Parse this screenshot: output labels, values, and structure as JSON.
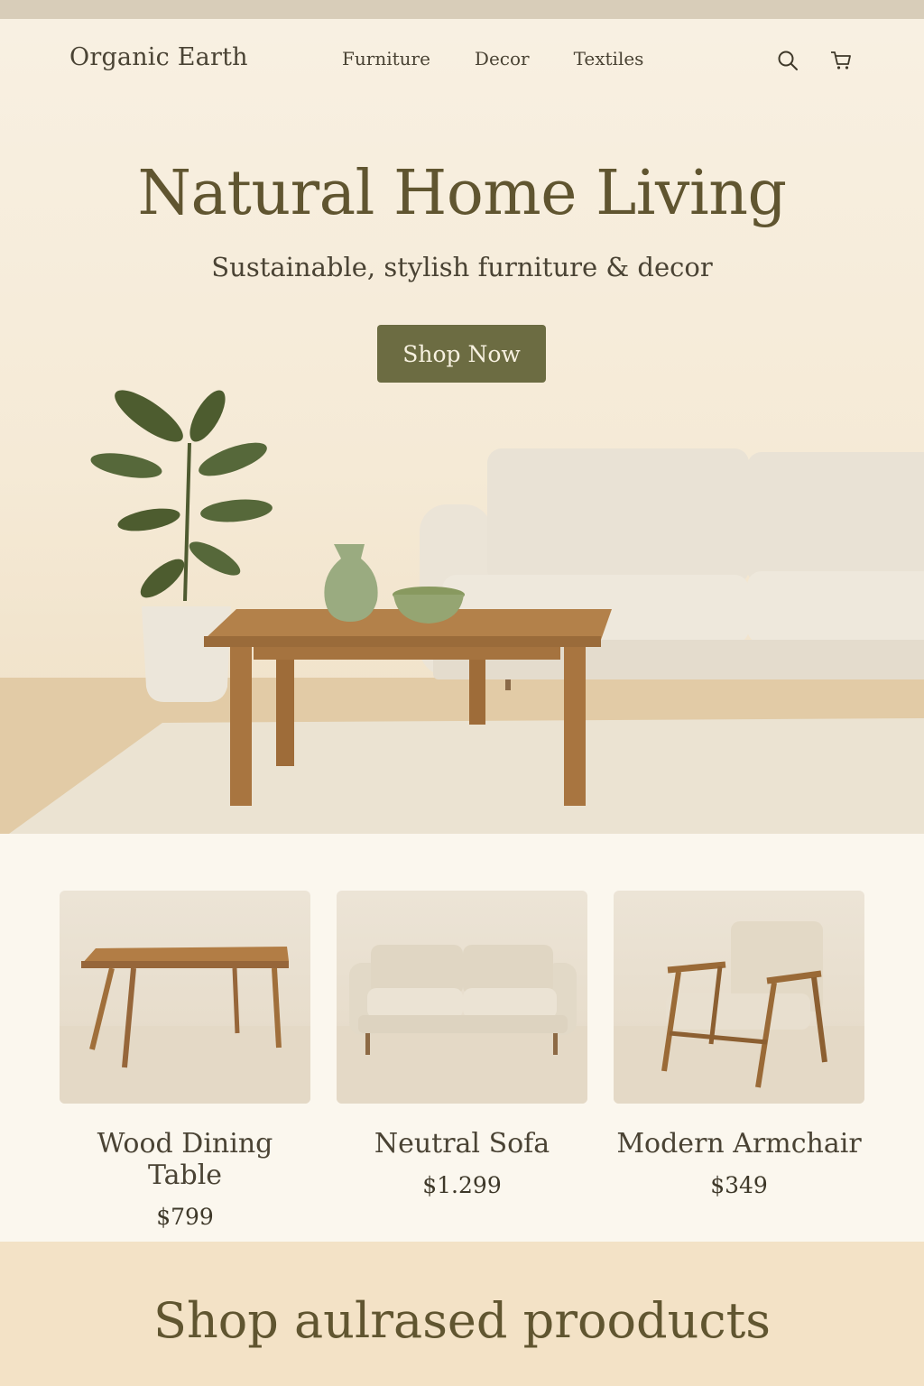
{
  "nav": {
    "brand": "Organic Earth",
    "links": [
      "Furniture",
      "Decor",
      "Textiles"
    ],
    "icons": [
      "search-icon",
      "cart-icon"
    ]
  },
  "hero": {
    "title": "Natural Home Living",
    "subtitle": "Sustainable, stylish furniture & decor",
    "cta_label": "Shop Now"
  },
  "products": [
    {
      "name": "Wood Dining Table",
      "price": "$799",
      "image": "wood-dining-table"
    },
    {
      "name": "Neutral Sofa",
      "price": "$1.299",
      "image": "neutral-sofa"
    },
    {
      "name": "Modern Armchair",
      "price": "$349",
      "image": "modern-armchair"
    }
  ],
  "bottom": {
    "title": "Shop aulrased prooducts"
  },
  "colors": {
    "accent": "#6c6c42",
    "heading": "#605530",
    "background": "#f7efe2",
    "bottom_band": "#f3e2c6"
  }
}
